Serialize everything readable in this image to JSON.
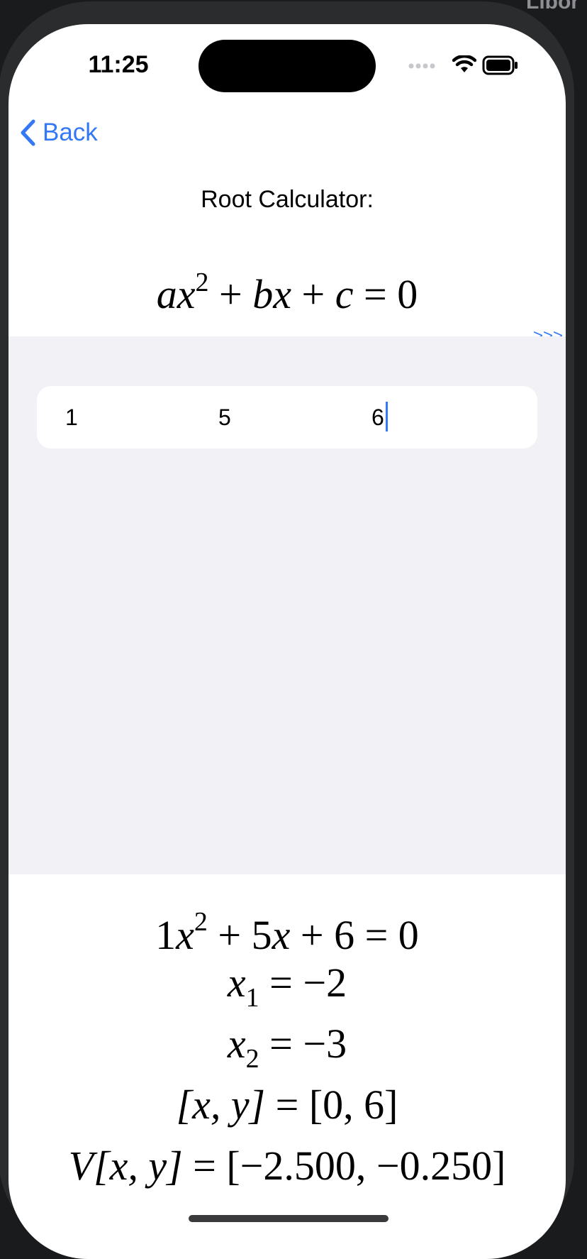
{
  "corner_text": "Libor I",
  "status": {
    "time": "11:25"
  },
  "nav": {
    "back_label": "Back"
  },
  "header": {
    "title": "Root Calculator:",
    "formula": {
      "a": "a",
      "x": "x",
      "exp": "2",
      "plus1": " + ",
      "b": "b",
      "plus2": " + ",
      "c": "c",
      "eq": " = 0"
    },
    "ellipsis": "...",
    "more_link": ">>>"
  },
  "inputs": {
    "a": "1",
    "b": "5",
    "c": "6"
  },
  "results": {
    "equation": {
      "a": "1",
      "x": "x",
      "exp": "2",
      "mid": " + 5",
      "x2": "x",
      "end": " + 6 = 0"
    },
    "root1": {
      "var": "x",
      "sub": "1",
      "value": " = −2"
    },
    "root2": {
      "var": "x",
      "sub": "2",
      "value": " = −3"
    },
    "intercept": {
      "lhs": "[x, y]",
      "value": " = [0, 6]"
    },
    "vertex": {
      "prefix": "V",
      "lhs": "[x, y]",
      "value": " = [−2.500, −0.250]"
    }
  }
}
